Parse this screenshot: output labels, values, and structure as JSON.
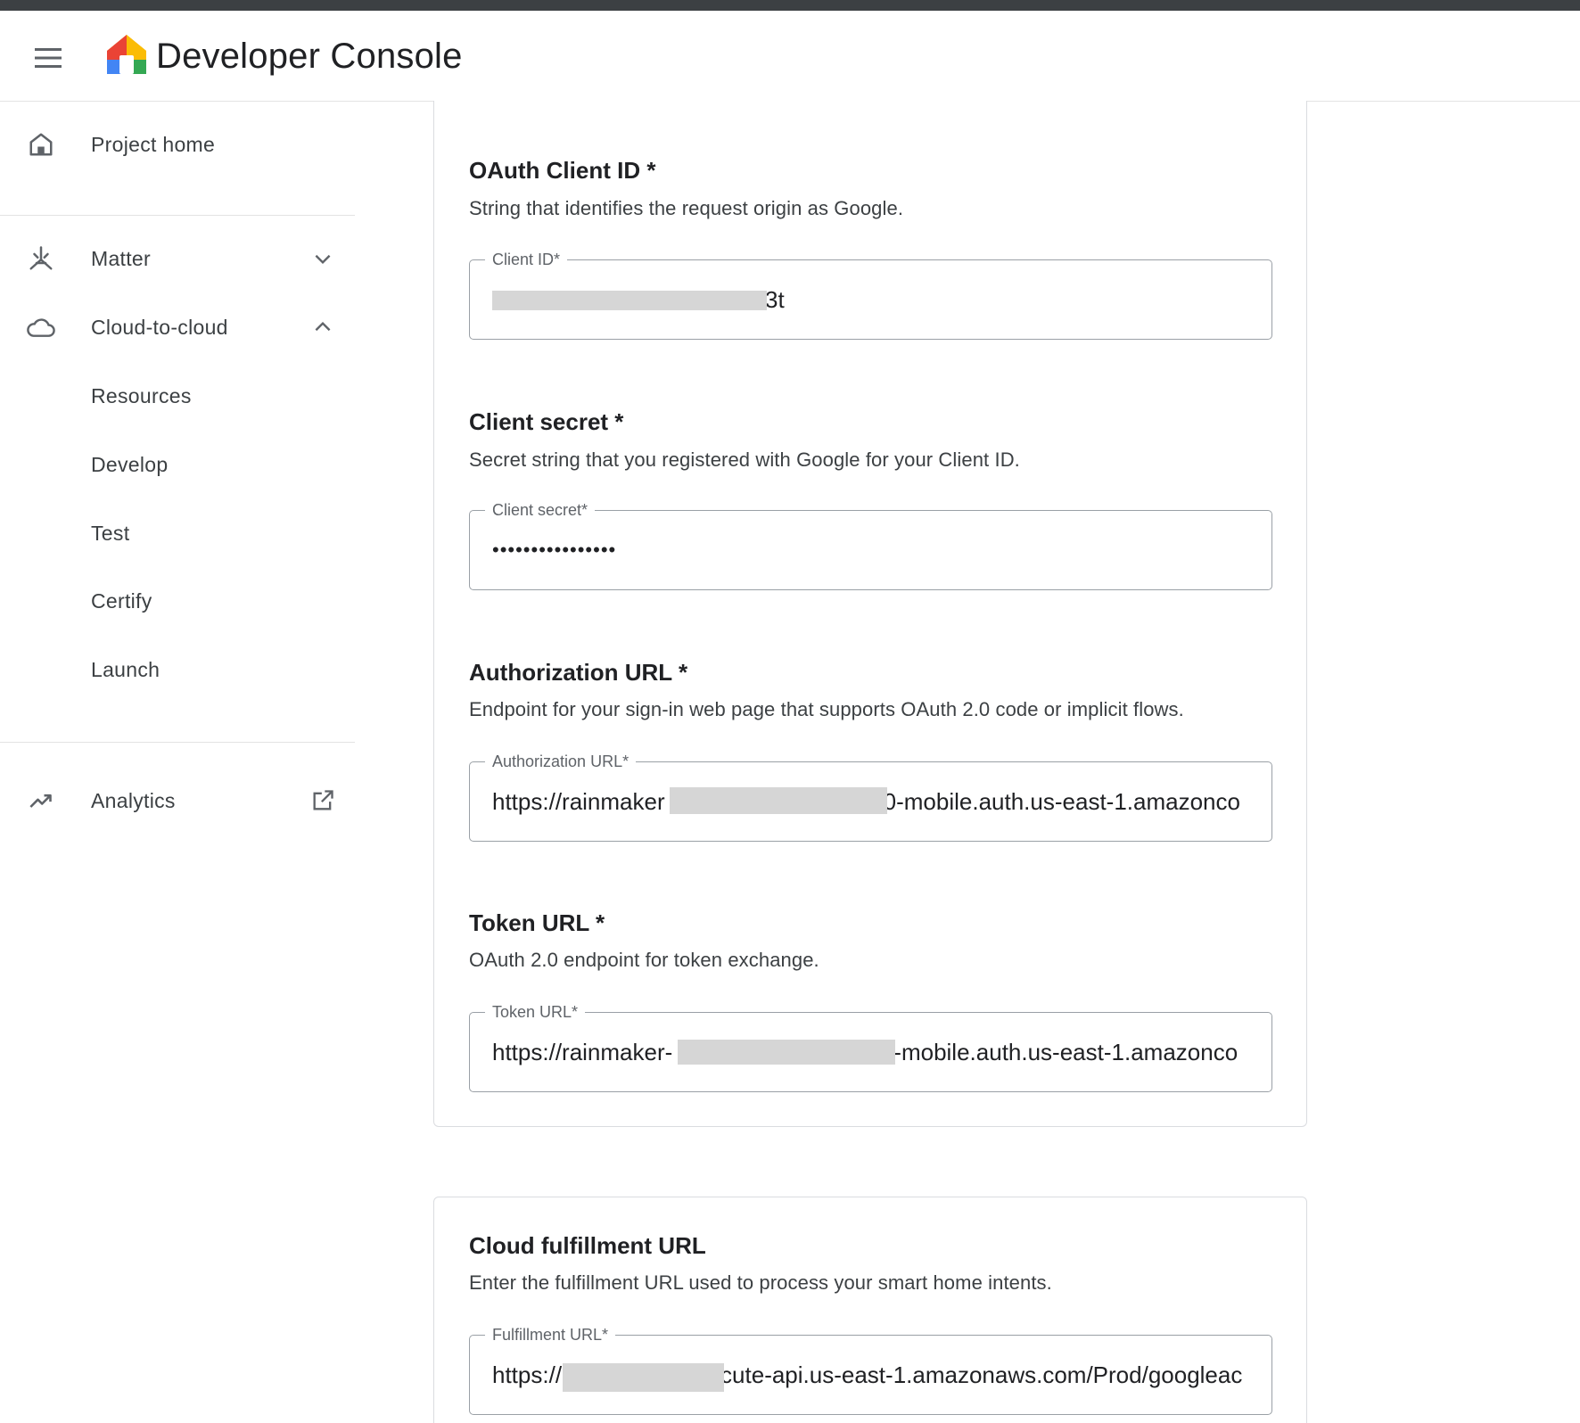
{
  "header": {
    "title": "Developer Console"
  },
  "sidebar": {
    "items": [
      {
        "label": "Project home",
        "icon": "home-icon"
      },
      {
        "label": "Matter",
        "icon": "matter-icon",
        "trailing": "chevron-down-icon"
      },
      {
        "label": "Cloud-to-cloud",
        "icon": "cloud-icon",
        "trailing": "chevron-up-icon"
      },
      {
        "label": "Analytics",
        "icon": "trending-up-icon",
        "trailing": "open-in-new-icon"
      }
    ],
    "sub_items": [
      "Resources",
      "Develop",
      "Test",
      "Certify",
      "Launch"
    ]
  },
  "sections": {
    "client_id": {
      "title": "OAuth Client ID *",
      "description": "String that identifies the request origin as Google.",
      "field_label": "Client ID*",
      "value": "3t"
    },
    "client_secret": {
      "title": "Client secret *",
      "description": "Secret string that you registered with Google for your Client ID.",
      "field_label": "Client secret*",
      "value": "••••••••••••••••"
    },
    "auth_url": {
      "title": "Authorization URL *",
      "description": "Endpoint for your sign-in web page that supports OAuth 2.0 code or implicit flows.",
      "field_label": "Authorization URL*",
      "value_prefix": "https://rainmaker",
      "value_suffix": "0-mobile.auth.us-east-1.amazonco"
    },
    "token_url": {
      "title": "Token URL *",
      "description": "OAuth 2.0 endpoint for token exchange.",
      "field_label": "Token URL*",
      "value_prefix": "https://rainmaker-",
      "value_suffix": "-mobile.auth.us-east-1.amazonco"
    },
    "fulfillment": {
      "title": "Cloud fulfillment URL",
      "description": "Enter the fulfillment URL used to process your smart home intents.",
      "field_label": "Fulfillment URL*",
      "value_prefix": "https://",
      "value_suffix": "cute-api.us-east-1.amazonaws.com/Prod/googleac"
    }
  },
  "colors": {
    "top_strip": "#3c4043",
    "border": "#dadce0",
    "field_border": "#9aa0a6",
    "redaction": "#d6d6d6"
  }
}
